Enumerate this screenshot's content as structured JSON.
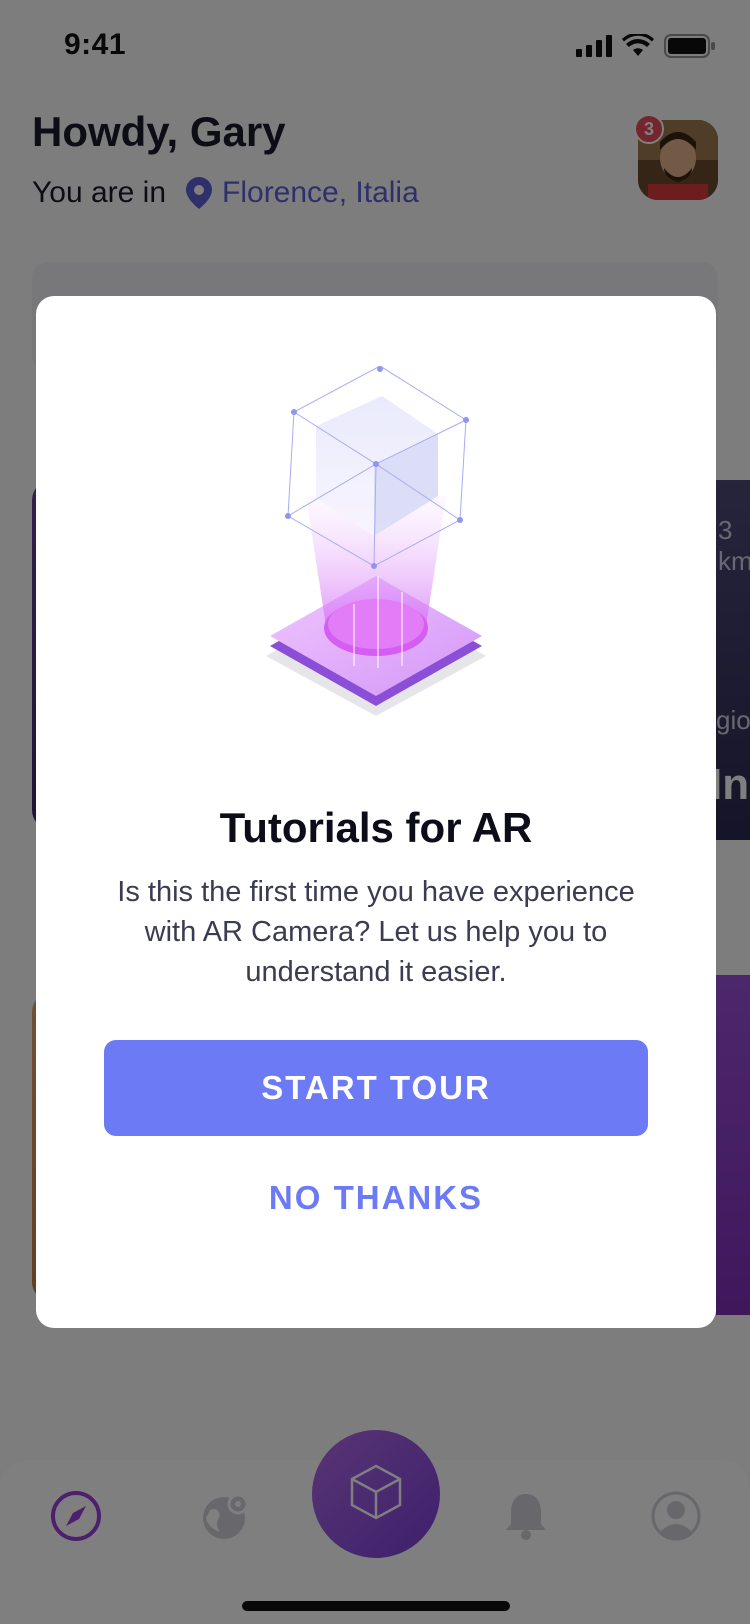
{
  "status_bar": {
    "time": "9:41",
    "icons": [
      "cellular-signal-icon",
      "wifi-icon",
      "battery-icon"
    ]
  },
  "header": {
    "greeting": "Howdy, Gary",
    "location_prefix": "You are in",
    "location_icon": "location-pin-icon",
    "location_city": "Florence, Italia",
    "notification_count": "3"
  },
  "background_cards": {
    "card_right_distance": "3 km",
    "card_right_region": "gio",
    "card_right_title": "In"
  },
  "modal": {
    "title": "Tutorials for AR",
    "body": "Is this the first time you have experience with AR Camera? Let us help you to understand it easier.",
    "primary_button": "START TOUR",
    "secondary_button": "NO THANKS",
    "illustration": "ar-cube-illustration"
  },
  "tab_bar": {
    "tabs": [
      "compass-icon",
      "globe-icon",
      "ar-cube-icon",
      "bell-icon",
      "profile-icon"
    ],
    "active": "compass-icon"
  },
  "colors": {
    "accent": "#6d7af5",
    "location_link": "#5d5fd6",
    "badge": "#e84c5c",
    "fab": "#9a55e0",
    "overlay": "rgba(0,0,0,0.5)"
  }
}
